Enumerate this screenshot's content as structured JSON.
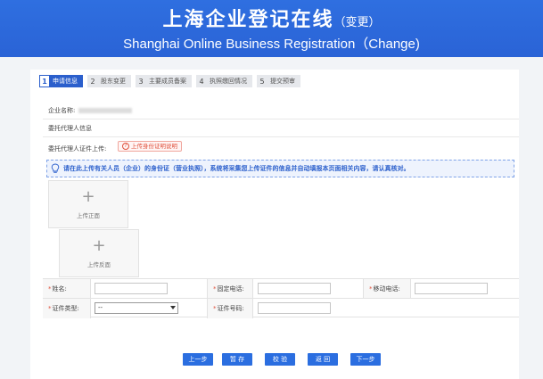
{
  "banner": {
    "title_cn": "上海企业登记在线",
    "title_sub": "（变更）",
    "title_en": "Shanghai Online Business Registration（Change)"
  },
  "steps": [
    {
      "num": "1",
      "label": "申请信息",
      "active": true
    },
    {
      "num": "2",
      "label": "股东变更",
      "active": false
    },
    {
      "num": "3",
      "label": "主要成员备案",
      "active": false
    },
    {
      "num": "4",
      "label": "执照缴回情况",
      "active": false
    },
    {
      "num": "5",
      "label": "提交预审",
      "active": false
    }
  ],
  "form": {
    "company_name_label": "企业名称:",
    "agent_info_label": "委托代理人信息",
    "agent_cert_upload_label": "委托代理人证件上传:",
    "upload_tip": "上传身份证明说明",
    "notice": "请在此上传有关人员（企业）的身份证（营业执照），系统将采集您上传证件的信息并自动填报本页面相关内容，请认真核对。",
    "upload_front": "上传正面",
    "upload_back": "上传反面",
    "name_label": "姓名:",
    "landline_label": "固定电话:",
    "mobile_label": "移动电话:",
    "cert_type_label": "证件类型:",
    "cert_type_value": "--",
    "cert_no_label": "证件号码:",
    "required_mark": "*"
  },
  "buttons": {
    "prev": "上一步",
    "save": "暂 存",
    "verify": "校 验",
    "back": "返 回",
    "next": "下一步"
  },
  "colors": {
    "primary": "#2b6ee0",
    "banner": "#2f6fe0",
    "required": "#e0533f"
  }
}
